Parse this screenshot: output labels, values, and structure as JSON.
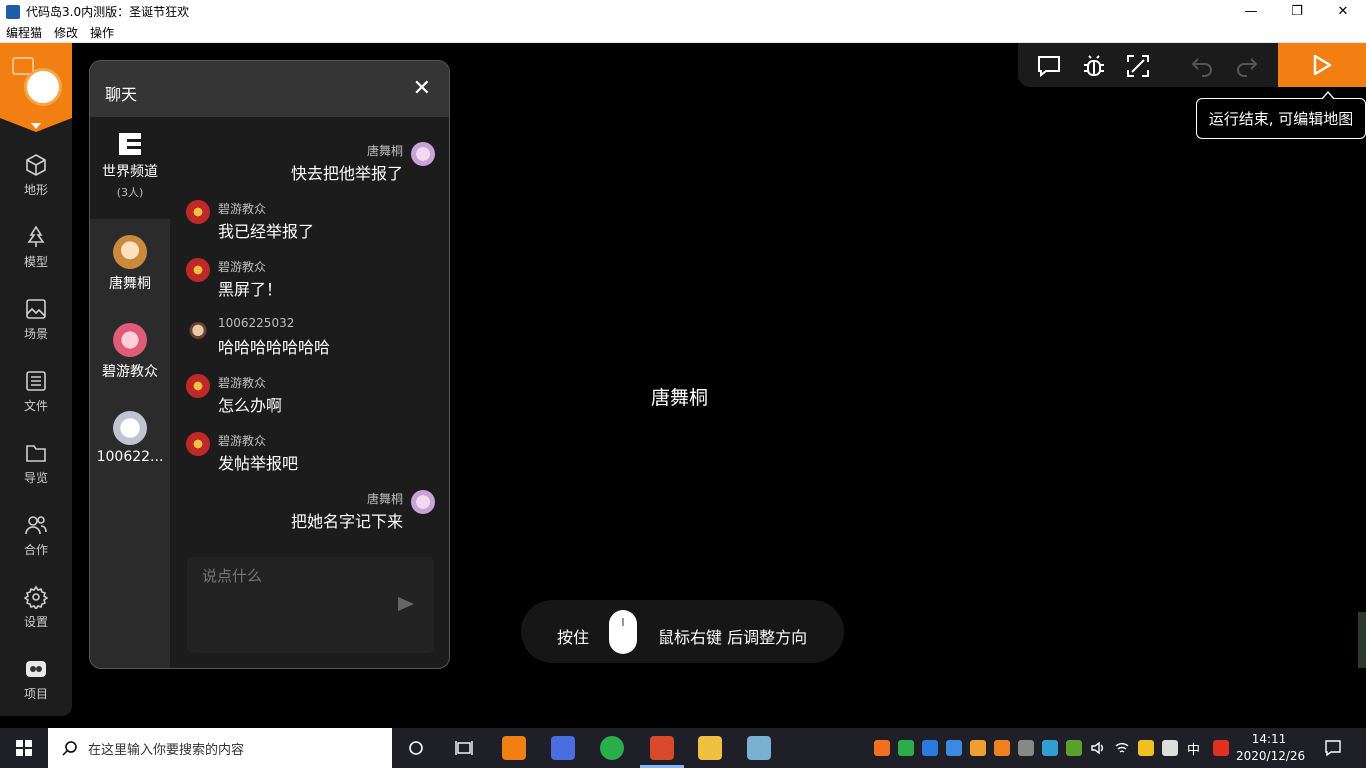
{
  "window": {
    "title": "代码岛3.0内测版：圣诞节狂欢",
    "min_glyph": "—",
    "max_glyph": "❐",
    "close_glyph": "✕"
  },
  "menu": [
    "编程猫",
    "修改",
    "操作"
  ],
  "rail": {
    "items": [
      {
        "label": "地形",
        "icon": "cube-icon"
      },
      {
        "label": "模型",
        "icon": "tree-icon"
      },
      {
        "label": "场景",
        "icon": "image-icon"
      },
      {
        "label": "文件",
        "icon": "file-list-icon"
      },
      {
        "label": "导览",
        "icon": "folder-icon"
      },
      {
        "label": "合作",
        "icon": "users-icon"
      },
      {
        "label": "设置",
        "icon": "gear-icon"
      },
      {
        "label": "项目",
        "icon": "project-icon"
      }
    ]
  },
  "chat": {
    "title": "聊天",
    "close_glyph": "✕",
    "channels": [
      {
        "name": "世界频道",
        "sub": "(3人)"
      },
      {
        "name": "唐舞桐"
      },
      {
        "name": "碧游教众"
      },
      {
        "name": "100622..."
      }
    ],
    "messages": [
      {
        "side": "right",
        "nick": "唐舞桐",
        "text": "快去把他举报了"
      },
      {
        "side": "left",
        "nick": "碧游教众",
        "text": "我已经举报了"
      },
      {
        "side": "left",
        "nick": "碧游教众",
        "text": "黑屏了！"
      },
      {
        "side": "left",
        "nick": "1006225032",
        "text": "哈哈哈哈哈哈哈"
      },
      {
        "side": "left",
        "nick": "碧游教众",
        "text": "怎么办啊"
      },
      {
        "side": "left",
        "nick": "碧游教众",
        "text": "发帖举报吧"
      },
      {
        "side": "right",
        "nick": "唐舞桐",
        "text": "把她名字记下来"
      }
    ],
    "input_placeholder": "说点什么"
  },
  "tooltip": "运行结束, 可编辑地图",
  "game": {
    "player_name": "唐舞桐",
    "hint_press": "按住",
    "hint_rest": "鼠标右键  后调整方向"
  },
  "taskbar": {
    "search_placeholder": "在这里输入你要搜索的内容",
    "lang": "中",
    "time": "14:11",
    "date": "2020/12/26"
  },
  "colors": {
    "accent": "#f27f12",
    "rail_bg": "#1d1d1d",
    "chat_bg": "#1c1c1c"
  }
}
